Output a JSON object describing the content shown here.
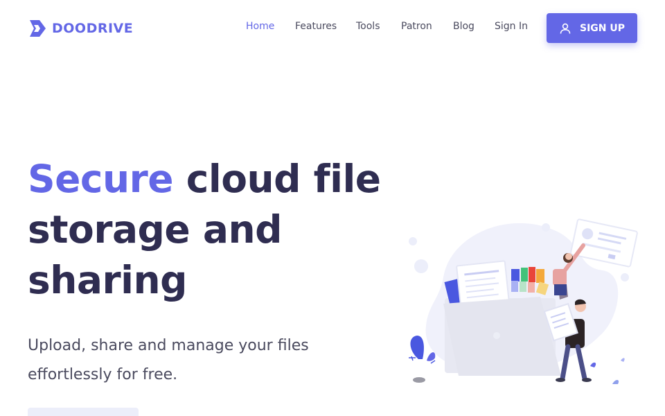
{
  "header": {
    "brand": {
      "name": "DOODRIVE",
      "icon": "doodrive-logo-icon",
      "color": "#6367e6"
    },
    "nav": [
      {
        "id": "home",
        "label": "Home",
        "active": true
      },
      {
        "id": "features",
        "label": "Features",
        "active": false
      },
      {
        "id": "tools",
        "label": "Tools",
        "active": false
      },
      {
        "id": "patron",
        "label": "Patron",
        "active": false
      },
      {
        "id": "blog",
        "label": "Blog",
        "active": false
      },
      {
        "id": "signin",
        "label": "Sign In",
        "active": false
      }
    ],
    "signup": {
      "label": "SIGN UP",
      "icon": "user-icon"
    }
  },
  "hero": {
    "title_accent": "Secure",
    "title_line1_rest": " cloud file",
    "title_line2": "storage and",
    "title_line3": "sharing",
    "subtitle_line1": "Upload, share and manage your files",
    "subtitle_line2": "effortlessly for free."
  },
  "illustration": {
    "icon": "cloud-file-storage-illustration"
  },
  "colors": {
    "accent": "#6367e6",
    "heading": "#2f2d51",
    "body_text": "#4a4a5e",
    "background": "#ffffff"
  }
}
